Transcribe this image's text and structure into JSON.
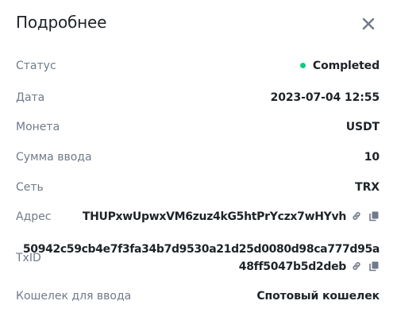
{
  "header": {
    "title": "Подробнее"
  },
  "colors": {
    "success": "#0ecb81",
    "label": "#707a8a",
    "icon": "#707a8a",
    "text": "#1e2329"
  },
  "details": {
    "status_label": "Статус",
    "status_value": "Completed",
    "date_label": "Дата",
    "date_value": "2023-07-04 12:55",
    "coin_label": "Монета",
    "coin_value": "USDT",
    "amount_label": "Сумма ввода",
    "amount_value": "10",
    "network_label": "Сеть",
    "network_value": "TRX",
    "address_label": "Адрес",
    "address_value": "THUPxwUpwxVM6zuz4kG5htPrYczx7wHYvh",
    "txid_label": "TxID",
    "txid_line1": "50942c59cb4e7f3fa34b7d9530a21d25d0080d98ca777d95a",
    "txid_line2": "48ff5047b5d2deb",
    "wallet_label": "Кошелек для ввода",
    "wallet_value": "Спотовый кошелек"
  },
  "icons": {
    "close": "close-icon",
    "link": "link-icon",
    "copy": "copy-icon"
  }
}
